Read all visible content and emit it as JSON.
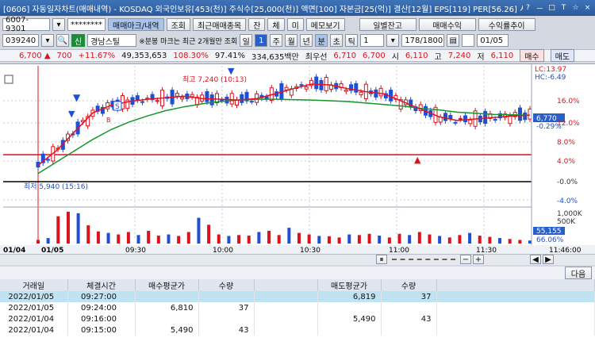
{
  "window": {
    "title": "[0606] 자동일자차트(매매내역) - KOSDAQ 외국인보유[453(천)] 주식수[25,000(천)] 액면[100] 자본금[25(억)] 결산[12월] EPS[119] PER[56.26] 시",
    "controls": [
      "?",
      "ㅡ",
      "□",
      "T",
      "☆",
      "×"
    ]
  },
  "toolbar1": {
    "account": "6007-9301",
    "password": "********",
    "tabs": [
      "매매마크/내역",
      "조회",
      "최근매매종목",
      "잔",
      "체",
      "미",
      "메모보기"
    ],
    "right_buttons": [
      "일별잔고",
      "매매수익",
      "수익률추이"
    ]
  },
  "toolbar2": {
    "code": "039240",
    "market_badge": "신",
    "stock_name": "경남스틸",
    "note": "※분봉 마크는 최근 2개월만 조회",
    "periods": [
      "일",
      "1",
      "주",
      "월",
      "년",
      "분",
      "초",
      "틱"
    ],
    "interval": "1",
    "count": "178/1800",
    "date": "01/05"
  },
  "quote": {
    "price": "6,700",
    "change": "700",
    "change_rate": "+11.67%",
    "volume": "49,353,653",
    "vol_ratio": "108.30%",
    "strength": "97.41%",
    "amount": "334,635백만",
    "best_label": "최우선",
    "ask": "6,710",
    "bid": "6,700",
    "open_label": "시",
    "open": "6,110",
    "high_label": "고",
    "high": "7,240",
    "low_label": "저",
    "low": "6,110",
    "buy_label": "매수",
    "sell_label": "매도"
  },
  "chart": {
    "high_annotation": "최고 7,240 (10:13)",
    "low_annotation": "최저 5,940 (15:16)",
    "lc": "LC:13.97",
    "hc": "HC:-6.49",
    "current_tag": "6,770",
    "current_pct": "-0.29%",
    "y_ticks": [
      "16.0%",
      "12.0%",
      "8.0%",
      "4.0%",
      "-0.0%",
      "-4.0%"
    ],
    "vol_ticks": [
      "1,000K",
      "500K"
    ],
    "vol_tag": "55,155",
    "vol_pct": "66.06%",
    "x_ticks": [
      "01/04",
      "01/05",
      "09:30",
      "10:00",
      "10:30",
      "11:00",
      "11:30",
      "11:46:00"
    ],
    "colors": {
      "up": "#d8141e",
      "down": "#1e4fd6",
      "ma_short": "#e0141e",
      "ma_long": "#14962a"
    }
  },
  "chart_data": {
    "type": "line",
    "series": [
      {
        "values": [
          6110,
          6300,
          6550,
          6800,
          6900,
          6950,
          6980,
          7000,
          7020,
          6990,
          6980,
          6970,
          6990,
          7050,
          7120,
          7180,
          7170,
          7120,
          7080,
          7050,
          6950,
          6850,
          6750,
          6700,
          6720,
          6740,
          6760,
          6770
        ]
      },
      {
        "values": [
          6000,
          6150,
          6300,
          6450,
          6580,
          6680,
          6760,
          6830,
          6880,
          6920,
          6950,
          6970,
          6980,
          6980,
          6975,
          6970,
          6960,
          6950,
          6930,
          6910,
          6890,
          6860,
          6840,
          6810,
          6795,
          6780,
          6775,
          6770
        ]
      }
    ],
    "volume": [
      120,
      180,
      900,
      1050,
      1000,
      600,
      400,
      350,
      300,
      380,
      280,
      420,
      260,
      300,
      250,
      380,
      850,
      620,
      300,
      250,
      280,
      260,
      380,
      420,
      280,
      520,
      350,
      300,
      250,
      240,
      200,
      300,
      280,
      320,
      260,
      200,
      320,
      280,
      380,
      300,
      250,
      200,
      280,
      350,
      260,
      220,
      180,
      150,
      120,
      100
    ]
  },
  "table": {
    "next_label": "다음",
    "headers": [
      "거래일",
      "체결시간",
      "매수평균가",
      "수량",
      "매도평균가",
      "수량"
    ],
    "rows": [
      [
        "2022/01/05",
        "09:27:00",
        "",
        "",
        "6,819",
        "37"
      ],
      [
        "2022/01/05",
        "09:24:00",
        "6,810",
        "37",
        "",
        ""
      ],
      [
        "2022/01/04",
        "09:16:00",
        "",
        "",
        "5,490",
        "43"
      ],
      [
        "2022/01/04",
        "09:15:00",
        "5,490",
        "43",
        "",
        ""
      ]
    ]
  }
}
